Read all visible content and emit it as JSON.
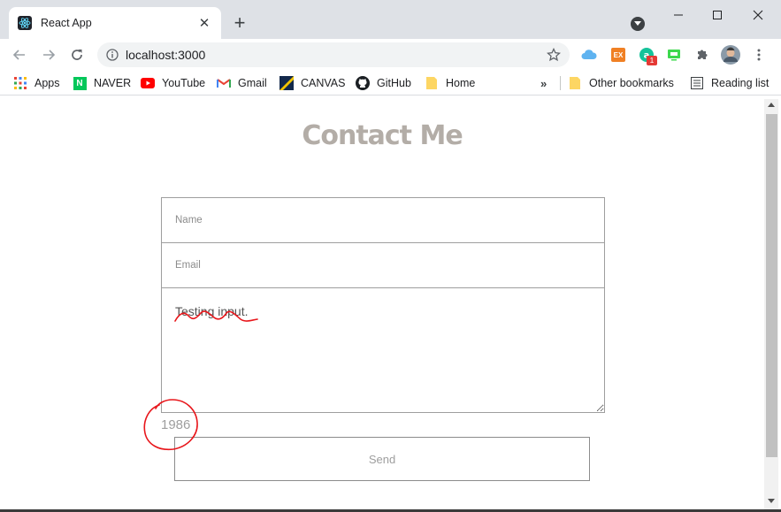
{
  "browser": {
    "tab_title": "React App",
    "url": "localhost:3000"
  },
  "bookmarks": [
    {
      "label": "Apps",
      "icon": "apps-grid-icon"
    },
    {
      "label": "NAVER",
      "icon": "naver-icon"
    },
    {
      "label": "YouTube",
      "icon": "youtube-icon"
    },
    {
      "label": "Gmail",
      "icon": "gmail-icon"
    },
    {
      "label": "CANVAS",
      "icon": "canvas-icon"
    },
    {
      "label": "GitHub",
      "icon": "github-icon"
    },
    {
      "label": "Home",
      "icon": "folder-icon"
    }
  ],
  "other_bookmarks": "Other bookmarks",
  "reading_list": "Reading list",
  "extensions": {
    "badge_count": "1"
  },
  "page": {
    "title": "Contact Me",
    "name_placeholder": "Name",
    "email_placeholder": "Email",
    "message_value": "Testing input.",
    "char_count": "1986",
    "send_label": "Send"
  },
  "colors": {
    "title": "#b3ada7",
    "annotation": "#e8161b",
    "accent_blue": "#1a73e8"
  }
}
